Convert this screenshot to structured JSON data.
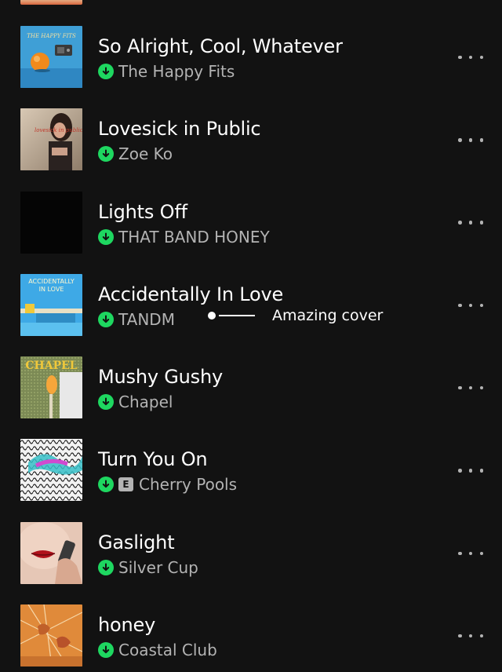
{
  "previous_item": {
    "art_icon": "album-cover-partial"
  },
  "tracks": [
    {
      "title": "So Alright, Cool, Whatever",
      "artist": "The Happy Fits",
      "downloaded": true,
      "explicit": false,
      "cover_text": "THE HAPPY FITS"
    },
    {
      "title": "Lovesick in Public",
      "artist": "Zoe Ko",
      "downloaded": true,
      "explicit": false,
      "cover_text": "lovesick in public"
    },
    {
      "title": "Lights Off",
      "artist": "THAT BAND HONEY",
      "downloaded": true,
      "explicit": false,
      "cover_text": ""
    },
    {
      "title": "Accidentally In Love",
      "artist": "TANDM",
      "downloaded": true,
      "explicit": false,
      "cover_text_line1": "ACCIDENTALLY",
      "cover_text_line2": "IN LOVE"
    },
    {
      "title": "Mushy Gushy",
      "artist": "Chapel",
      "downloaded": true,
      "explicit": false,
      "cover_text": "CHAPEL"
    },
    {
      "title": "Turn You On",
      "artist": "Cherry Pools",
      "downloaded": true,
      "explicit": true,
      "explicit_label": "E",
      "cover_text": ""
    },
    {
      "title": "Gaslight",
      "artist": "Silver Cup",
      "downloaded": true,
      "explicit": false,
      "cover_text": ""
    },
    {
      "title": "honey",
      "artist": "Coastal Club",
      "downloaded": true,
      "explicit": false,
      "cover_text": ""
    }
  ],
  "annotation": {
    "text": "Amazing cover"
  },
  "colors": {
    "background": "#121212",
    "primary_text": "#ffffff",
    "secondary_text": "#b3b3b3",
    "download_green": "#1ed760"
  },
  "icons": {
    "download": "download-icon",
    "more": "more-options-icon"
  }
}
